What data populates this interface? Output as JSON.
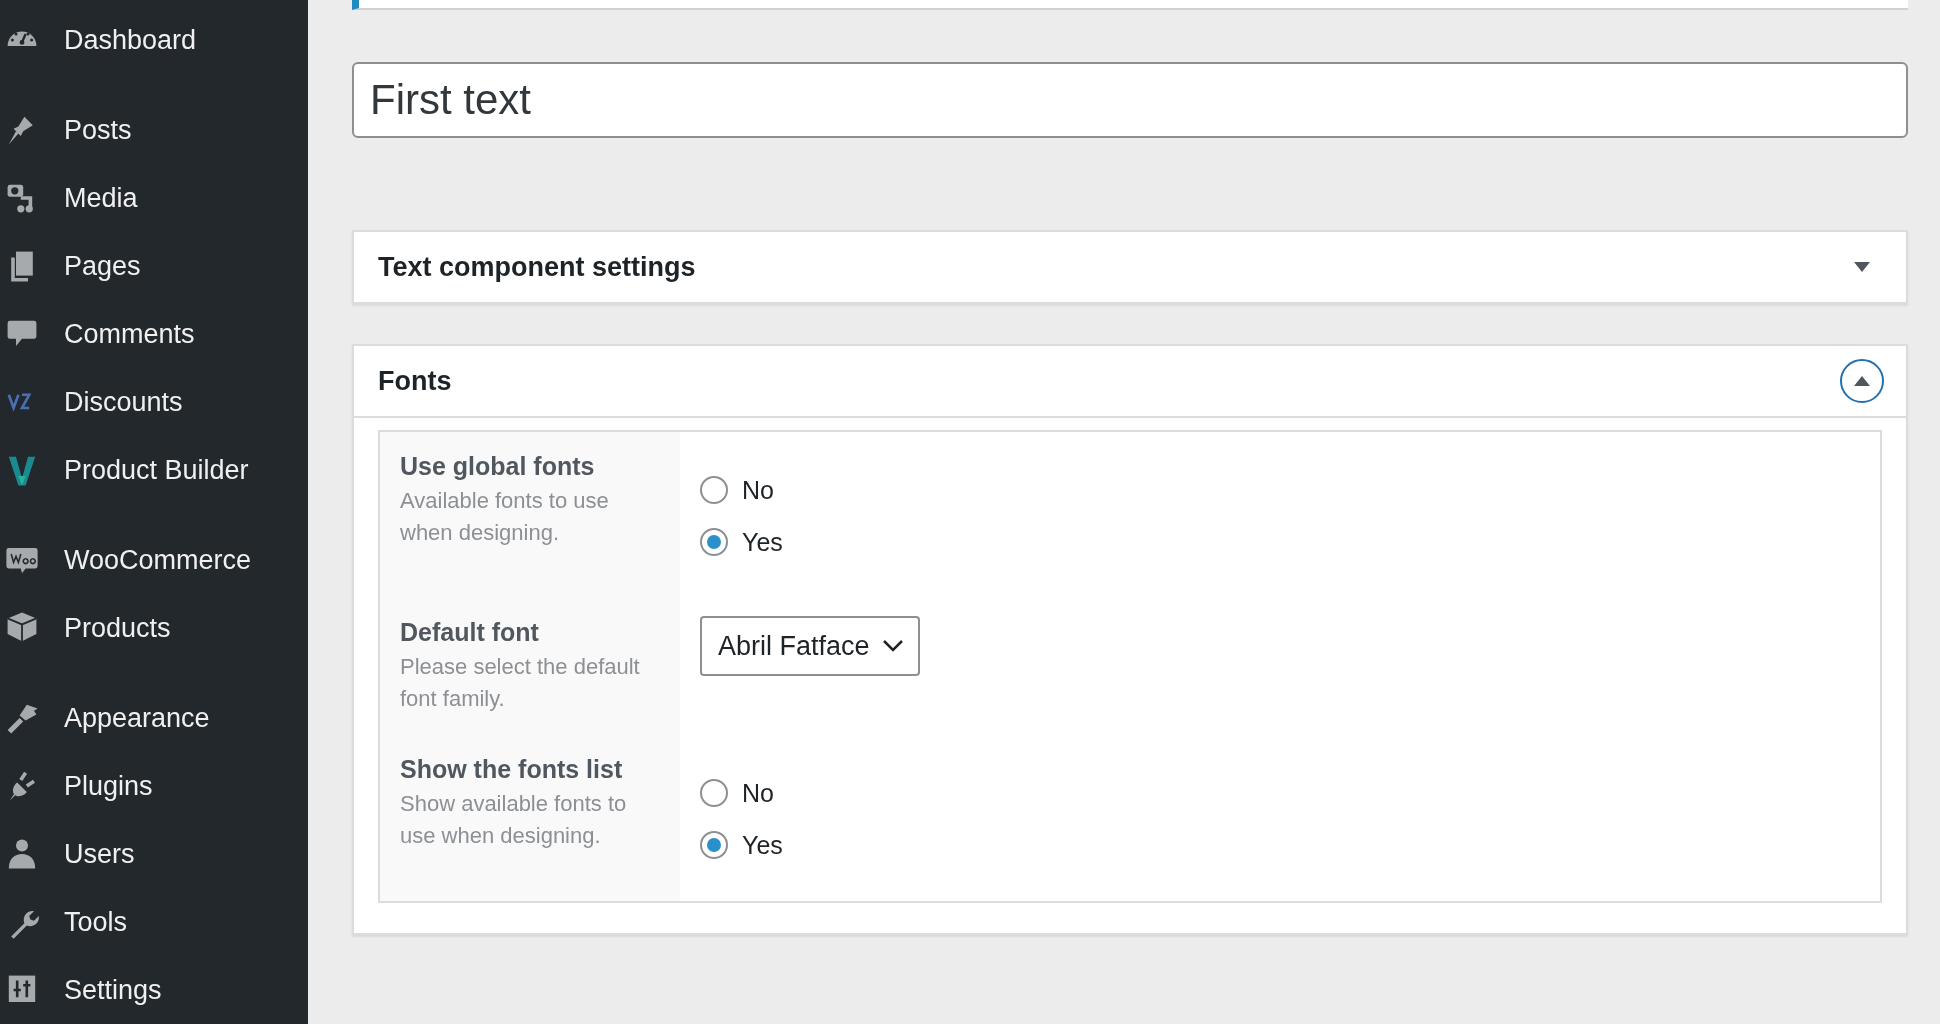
{
  "sidebar": {
    "groups": [
      {
        "items": [
          {
            "label": "Dashboard"
          }
        ]
      },
      {
        "items": [
          {
            "label": "Posts"
          },
          {
            "label": "Media"
          },
          {
            "label": "Pages"
          },
          {
            "label": "Comments"
          },
          {
            "label": "Discounts"
          },
          {
            "label": "Product Builder"
          }
        ]
      },
      {
        "items": [
          {
            "label": "WooCommerce"
          },
          {
            "label": "Products"
          }
        ]
      },
      {
        "items": [
          {
            "label": "Appearance"
          },
          {
            "label": "Plugins"
          },
          {
            "label": "Users"
          },
          {
            "label": "Tools"
          },
          {
            "label": "Settings"
          }
        ]
      }
    ]
  },
  "title_field": {
    "value": "First text"
  },
  "panels": [
    {
      "title": "Text component settings",
      "expanded": false
    },
    {
      "title": "Fonts",
      "expanded": true,
      "settings": [
        {
          "kind": "radio",
          "label": "Use global fonts",
          "description": "Available fonts to use when designing.",
          "options": [
            {
              "label": "No",
              "selected": false
            },
            {
              "label": "Yes",
              "selected": true
            }
          ]
        },
        {
          "kind": "select",
          "label": "Default font",
          "description": "Please select the default font family.",
          "value": "Abril Fatface"
        },
        {
          "kind": "radio",
          "label": "Show the fonts list",
          "description": "Show available fonts to use when designing.",
          "options": [
            {
              "label": "No",
              "selected": false
            },
            {
              "label": "Yes",
              "selected": true
            }
          ]
        }
      ]
    }
  ]
}
